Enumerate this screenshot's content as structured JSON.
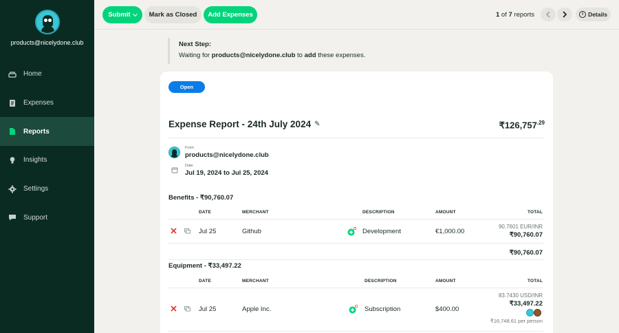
{
  "sidebar": {
    "profile_email": "products@nicelydone.club",
    "items": [
      {
        "label": "Home",
        "icon": "home-icon"
      },
      {
        "label": "Expenses",
        "icon": "receipt-icon"
      },
      {
        "label": "Reports",
        "icon": "document-icon",
        "active": true
      },
      {
        "label": "Insights",
        "icon": "lightbulb-icon"
      },
      {
        "label": "Settings",
        "icon": "gear-icon"
      },
      {
        "label": "Support",
        "icon": "chat-icon"
      }
    ]
  },
  "toolbar": {
    "submit_label": "Submit",
    "mark_closed_label": "Mark as Closed",
    "add_expenses_label": "Add Expenses",
    "pager_current": "1",
    "pager_of": "of",
    "pager_total": "7",
    "pager_suffix": "reports",
    "details_label": "Details"
  },
  "next_step": {
    "title": "Next Step:",
    "prefix": "Waiting for",
    "user": "products@nicelydone.club",
    "middle": "to",
    "action": "add",
    "suffix": "these expenses."
  },
  "report": {
    "status": "Open",
    "title": "Expense Report - 24th July 2024",
    "total_main": "₹126,757",
    "total_decimals": ".29",
    "from_label": "From",
    "from_value": "products@nicelydone.club",
    "date_label": "Date",
    "date_value": "Jul 19, 2024 to Jul 25, 2024"
  },
  "columns": {
    "date": "DATE",
    "merchant": "MERCHANT",
    "description": "DESCRIPTION",
    "amount": "AMOUNT",
    "total": "TOTAL"
  },
  "sections": [
    {
      "title": "Benefits - ₹90,760.07",
      "rows": [
        {
          "date": "Jul 25",
          "merchant": "Github",
          "description": "Development",
          "amount": "€1,000.00",
          "rate": "90.7601  EUR/INR",
          "total": "₹90,760.07"
        }
      ],
      "subtotal": "₹90,760.07"
    },
    {
      "title": "Equipment - ₹33,497.22",
      "rows": [
        {
          "date": "Jul 25",
          "merchant": "Apple Inc.",
          "description": "Subscription",
          "amount": "$400.00",
          "rate": "83.7430  USD/INR",
          "total": "₹33,497.22",
          "per_person": "₹16,748.61 per person"
        }
      ]
    }
  ],
  "colors": {
    "sidebar_bg": "#0a2b22",
    "accent_green": "#03d47c",
    "badge_blue": "#0b7de8",
    "reject_red": "#e53935"
  }
}
